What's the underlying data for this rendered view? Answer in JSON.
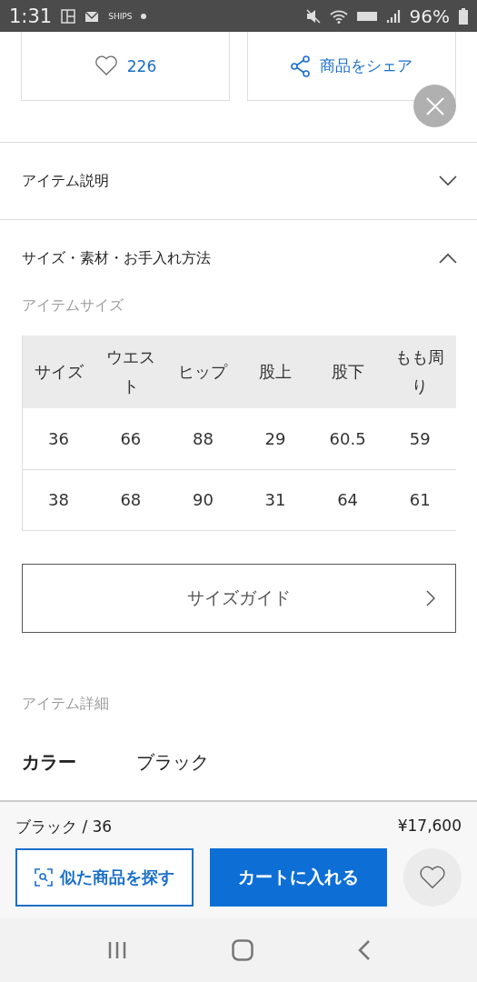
{
  "status_bar": {
    "time": "1:31",
    "app_label": "SHIPS",
    "battery": "96%"
  },
  "actions": {
    "likes": "226",
    "share": "商品をシェア"
  },
  "accordions": [
    {
      "title": "アイテム説明",
      "expanded": false
    },
    {
      "title": "サイズ・素材・お手入れ方法",
      "expanded": true
    }
  ],
  "size_section": {
    "heading": "アイテムサイズ",
    "table": {
      "columns": [
        "サイズ",
        "ウエスト",
        "ヒップ",
        "股上",
        "股下",
        "もも周り"
      ],
      "rows": [
        [
          "36",
          "66",
          "88",
          "29",
          "60.5",
          "59"
        ],
        [
          "38",
          "68",
          "90",
          "31",
          "64",
          "61"
        ]
      ]
    },
    "guide_button": "サイズガイド"
  },
  "details": {
    "heading": "アイテム詳細",
    "rows": [
      {
        "label": "カラー",
        "value": "ブラック"
      }
    ]
  },
  "purchase_bar": {
    "selection": "ブラック / 36",
    "price": "¥17,600",
    "similar_button": "似た商品を探す",
    "cart_button": "カートに入れる"
  }
}
